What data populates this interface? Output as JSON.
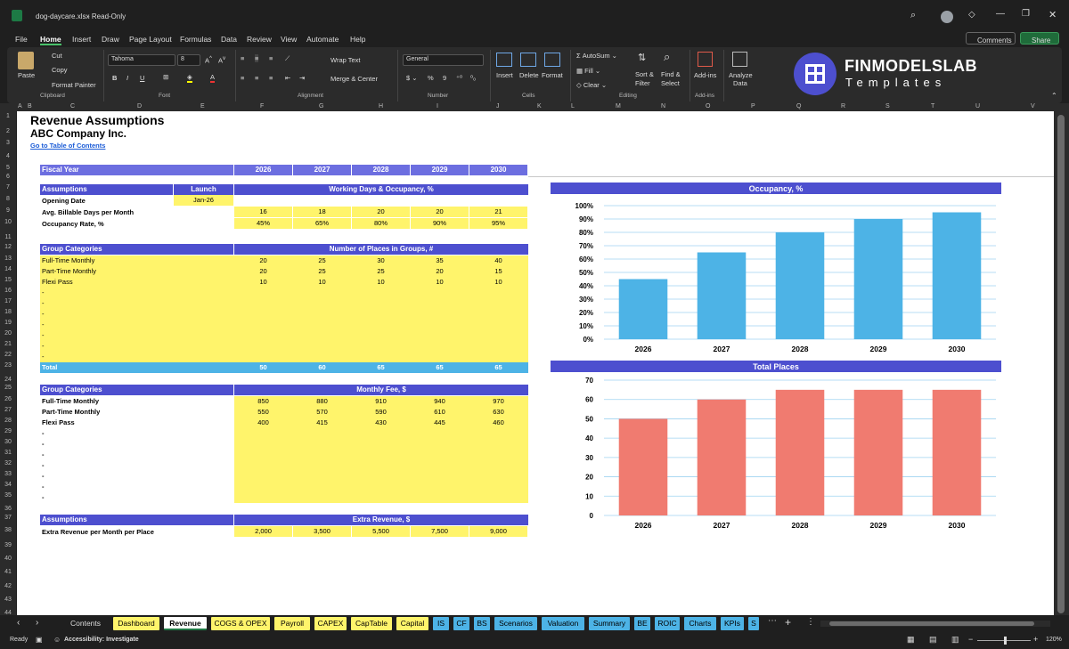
{
  "window": {
    "filename": "dog-daycare.xlsx",
    "mode": "Read-Only"
  },
  "menu": [
    "File",
    "Home",
    "Insert",
    "Draw",
    "Page Layout",
    "Formulas",
    "Data",
    "Review",
    "View",
    "Automate",
    "Help"
  ],
  "menu_active": "Home",
  "top_right": {
    "comments": "Comments",
    "share": "Share"
  },
  "ribbon": {
    "clipboard": {
      "paste": "Paste",
      "cut": "Cut",
      "copy": "Copy",
      "format_painter": "Format Painter",
      "label": "Clipboard"
    },
    "font": {
      "name": "Tahoma",
      "size": "8",
      "label": "Font"
    },
    "alignment": {
      "wrap": "Wrap Text",
      "merge": "Merge & Center",
      "label": "Alignment"
    },
    "number": {
      "format": "General",
      "label": "Number"
    },
    "cells": {
      "insert": "Insert",
      "delete": "Delete",
      "format": "Format",
      "label": "Cells"
    },
    "editing": {
      "autosum": "AutoSum",
      "fill": "Fill",
      "clear": "Clear",
      "sort": "Sort &",
      "sort2": "Filter",
      "find": "Find &",
      "find2": "Select",
      "label": "Editing"
    },
    "addins": {
      "addins": "Add-ins",
      "label": "Add-ins",
      "analyze": "Analyze",
      "analyze2": "Data"
    },
    "brand": {
      "name": "FINMODELSLAB",
      "sub": "Templates"
    }
  },
  "columns": [
    "A",
    "B",
    "C",
    "D",
    "E",
    "F",
    "G",
    "H",
    "I",
    "J",
    "K",
    "L",
    "M",
    "N",
    "O",
    "P",
    "Q",
    "R",
    "S",
    "T",
    "U",
    "V"
  ],
  "rows": [
    "1",
    "2",
    "3",
    "4",
    "5",
    "6",
    "7",
    "8",
    "9",
    "10",
    "11",
    "12",
    "13",
    "14",
    "15",
    "16",
    "17",
    "18",
    "19",
    "20",
    "21",
    "22",
    "23",
    "24",
    "25",
    "26",
    "27",
    "28",
    "29",
    "30",
    "31",
    "32",
    "33",
    "34",
    "35",
    "36",
    "37",
    "38",
    "39",
    "40",
    "41",
    "42",
    "43",
    "44"
  ],
  "sheet": {
    "title": "Revenue Assumptions",
    "company": "ABC Company Inc.",
    "toc_link": "Go to Table of Contents",
    "fiscal_year_label": "Fiscal Year",
    "years": [
      "2026",
      "2027",
      "2028",
      "2029",
      "2030"
    ],
    "assumptions": {
      "label": "Assumptions",
      "launch": "Launch",
      "section": "Working Days & Occupancy, %",
      "opening_date_label": "Opening Date",
      "opening_date": "Jan-26",
      "billable_label": "Avg. Billable Days per Month",
      "billable": [
        "16",
        "18",
        "20",
        "20",
        "21"
      ],
      "occupancy_label": "Occupancy Rate, %",
      "occupancy": [
        "45%",
        "65%",
        "80%",
        "90%",
        "95%"
      ]
    },
    "places": {
      "label": "Group Categories",
      "section": "Number of Places in Groups, #",
      "rows": [
        {
          "name": "Full-Time Monthly",
          "vals": [
            "20",
            "25",
            "30",
            "35",
            "40"
          ]
        },
        {
          "name": "Part-Time Monthly",
          "vals": [
            "20",
            "25",
            "25",
            "20",
            "15"
          ]
        },
        {
          "name": "Flexi Pass",
          "vals": [
            "10",
            "10",
            "10",
            "10",
            "10"
          ]
        }
      ],
      "blank": "-",
      "total_label": "Total",
      "totals": [
        "50",
        "60",
        "65",
        "65",
        "65"
      ]
    },
    "fees": {
      "label": "Group Categories",
      "section": "Monthly Fee, $",
      "rows": [
        {
          "name": "Full-Time Monthly",
          "vals": [
            "850",
            "880",
            "910",
            "940",
            "970"
          ]
        },
        {
          "name": "Part-Time Monthly",
          "vals": [
            "550",
            "570",
            "590",
            "610",
            "630"
          ]
        },
        {
          "name": "Flexi Pass",
          "vals": [
            "400",
            "415",
            "430",
            "445",
            "460"
          ]
        }
      ],
      "blank": "-"
    },
    "extra": {
      "label": "Assumptions",
      "section": "Extra Revenue, $",
      "row_label": "Extra Revenue per Month per Place",
      "vals": [
        "2,000",
        "3,500",
        "5,500",
        "7,500",
        "9,000"
      ]
    }
  },
  "chart_data": [
    {
      "type": "bar",
      "title": "Occupancy, %",
      "categories": [
        "2026",
        "2027",
        "2028",
        "2029",
        "2030"
      ],
      "values": [
        45,
        65,
        80,
        90,
        95
      ],
      "ylim": [
        0,
        100
      ],
      "yticks": [
        "0%",
        "10%",
        "20%",
        "30%",
        "40%",
        "50%",
        "60%",
        "70%",
        "80%",
        "90%",
        "100%"
      ],
      "color": "#4db3e6",
      "grid": true
    },
    {
      "type": "bar",
      "title": "Total Places",
      "categories": [
        "2026",
        "2027",
        "2028",
        "2029",
        "2030"
      ],
      "values": [
        50,
        60,
        65,
        65,
        65
      ],
      "ylim": [
        0,
        70
      ],
      "yticks": [
        "0",
        "10",
        "20",
        "30",
        "40",
        "50",
        "60",
        "70"
      ],
      "color": "#f07b70",
      "grid": true
    }
  ],
  "tabs": [
    {
      "label": "Contents",
      "color": "#1f1f1f",
      "text": "#ddd"
    },
    {
      "label": "Dashboard",
      "color": "#fff46b"
    },
    {
      "label": "Revenue",
      "color": "#ffffff",
      "active": true
    },
    {
      "label": "COGS & OPEX",
      "color": "#fff46b"
    },
    {
      "label": "Payroll",
      "color": "#fff46b"
    },
    {
      "label": "CAPEX",
      "color": "#fff46b"
    },
    {
      "label": "CapTable",
      "color": "#fff46b"
    },
    {
      "label": "Capital",
      "color": "#fff46b"
    },
    {
      "label": "IS",
      "color": "#4db3e6"
    },
    {
      "label": "CF",
      "color": "#4db3e6"
    },
    {
      "label": "BS",
      "color": "#4db3e6"
    },
    {
      "label": "Scenarios",
      "color": "#4db3e6"
    },
    {
      "label": "Valuation",
      "color": "#4db3e6"
    },
    {
      "label": "Summary",
      "color": "#4db3e6"
    },
    {
      "label": "BE",
      "color": "#4db3e6"
    },
    {
      "label": "ROIC",
      "color": "#4db3e6"
    },
    {
      "label": "Charts",
      "color": "#4db3e6"
    },
    {
      "label": "KPIs",
      "color": "#4db3e6"
    },
    {
      "label": "S",
      "color": "#4db3e6"
    }
  ],
  "status": {
    "ready": "Ready",
    "accessibility": "Accessibility: Investigate",
    "zoom": "120%"
  }
}
